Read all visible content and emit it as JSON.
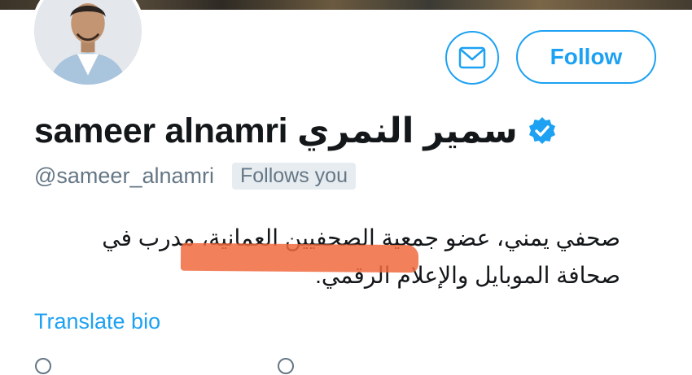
{
  "profile": {
    "display_name": "sameer alnamri سمير النمري",
    "handle": "@sameer_alnamri",
    "follows_you": "Follows you",
    "bio": "صحفي يمني، عضو جمعية الصحفيين العمانية، مدرب في صحافة الموبايل والإعلام الرقمي.",
    "translate_label": "Translate bio"
  },
  "actions": {
    "follow_label": "Follow"
  },
  "colors": {
    "accent": "#1da1f2",
    "secondary_text": "#657786",
    "primary_text": "#14171a",
    "badge_bg": "#e6ecf0",
    "redaction": "#f06a3e"
  },
  "icons": {
    "message": "envelope-icon",
    "verified": "verified-badge-icon",
    "meta": [
      "location-icon",
      "link-icon"
    ]
  }
}
